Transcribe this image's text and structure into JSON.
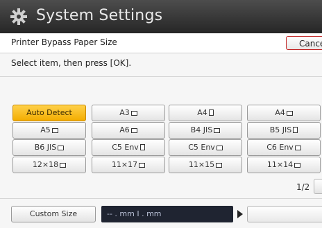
{
  "titlebar": {
    "title": "System Settings",
    "icon": "gear-icon"
  },
  "header": {
    "subtitle": "Printer Bypass Paper Size",
    "cancel_label": "Cancel"
  },
  "instruction": "Select item, then press [OK].",
  "options": [
    {
      "label": "Auto Detect",
      "icon": "",
      "selected": true
    },
    {
      "label": "A3",
      "icon": "landscape",
      "selected": false
    },
    {
      "label": "A4",
      "icon": "portrait",
      "selected": false
    },
    {
      "label": "A4",
      "icon": "landscape",
      "selected": false
    },
    {
      "label": "A5",
      "icon": "landscape",
      "selected": false
    },
    {
      "label": "A6",
      "icon": "landscape",
      "selected": false
    },
    {
      "label": "B4 JIS",
      "icon": "landscape",
      "selected": false
    },
    {
      "label": "B5 JIS",
      "icon": "portrait",
      "selected": false
    },
    {
      "label": "B6 JIS",
      "icon": "landscape",
      "selected": false
    },
    {
      "label": "C5 Env",
      "icon": "portrait",
      "selected": false
    },
    {
      "label": "C5 Env",
      "icon": "landscape",
      "selected": false
    },
    {
      "label": "C6 Env",
      "icon": "landscape",
      "selected": false
    },
    {
      "label": "12×18",
      "icon": "landscape",
      "selected": false
    },
    {
      "label": "11×17",
      "icon": "landscape",
      "selected": false
    },
    {
      "label": "11×15",
      "icon": "landscape",
      "selected": false
    },
    {
      "label": "11×14",
      "icon": "landscape",
      "selected": false
    }
  ],
  "pagination": {
    "page": "1/2"
  },
  "custom": {
    "button_label": "Custom Size",
    "size_display": "-- . mm I . mm"
  },
  "colors": {
    "selected": "#f3ad00",
    "titlebar": "#2b2b2b",
    "cancel_border": "#c22626",
    "display_bg": "#1f2431"
  }
}
